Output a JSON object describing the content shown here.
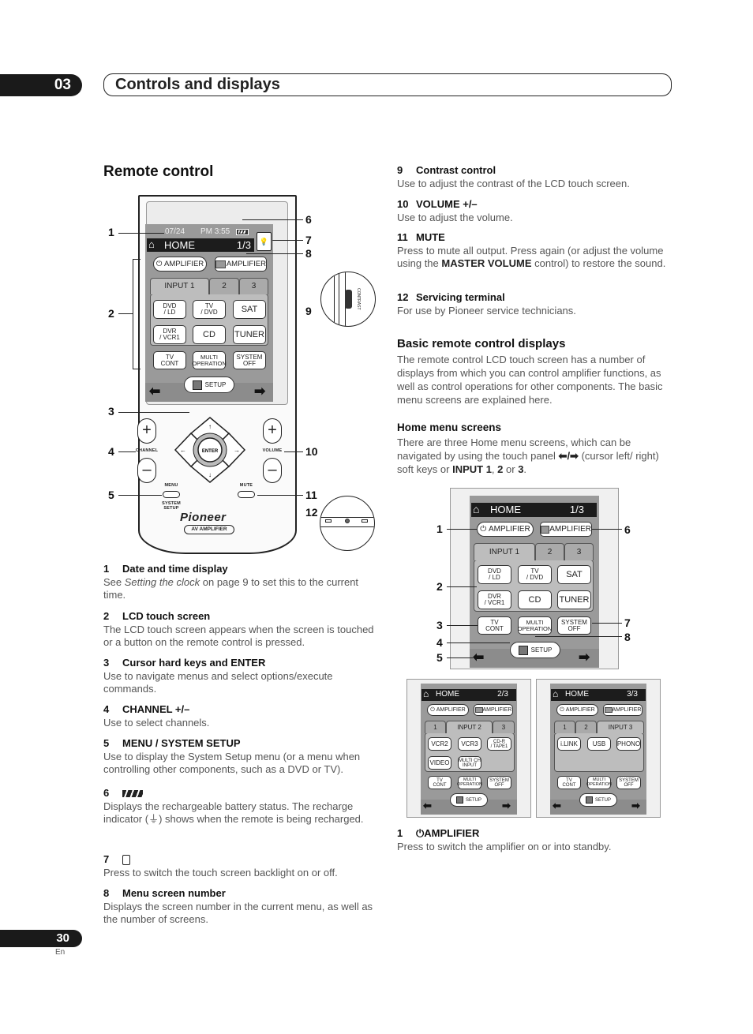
{
  "header": {
    "chapter_number": "03",
    "chapter_title": "Controls and displays"
  },
  "footer": {
    "page_number": "30",
    "language": "En"
  },
  "left": {
    "section_title": "Remote control",
    "remote": {
      "date": "07/24",
      "time": "PM 3:55",
      "home_label": "HOME",
      "screen_number": "1/3",
      "power_amp_label": "AMPLIFIER",
      "amp_label": "AMPLIFIER",
      "tabs": [
        "INPUT 1",
        "2",
        "3"
      ],
      "input_buttons": [
        [
          "DVD",
          "/ LD"
        ],
        [
          "TV",
          "/ DVD"
        ],
        [
          "SAT"
        ],
        [
          "DVR",
          "/ VCR1"
        ],
        [
          "CD"
        ],
        [
          "TUNER"
        ]
      ],
      "bottom_buttons": [
        [
          "TV",
          "CONT"
        ],
        [
          "MULTI",
          "OPERATION"
        ],
        [
          "SYSTEM",
          "OFF"
        ]
      ],
      "setup_label": "SETUP",
      "channel_label": "CHANNEL",
      "volume_label": "VOLUME",
      "enter_label": "ENTER",
      "menu_label": "MENU",
      "system_setup_label": [
        "SYSTEM",
        "SETUP"
      ],
      "mute_label": "MUTE",
      "brand": "Pioneer",
      "model_label": "AV AMPLIFIER",
      "contrast_label": "CONTRAST",
      "callouts": [
        "1",
        "2",
        "3",
        "4",
        "5",
        "6",
        "7",
        "8",
        "9",
        "10",
        "11",
        "12"
      ]
    },
    "items": [
      {
        "num": "1",
        "title": "Date and time display",
        "body_pre": "See ",
        "body_italic": "Setting the clock",
        "body_post": " on page 9 to set this to the current time."
      },
      {
        "num": "2",
        "title": "LCD touch screen",
        "body": "The LCD touch screen appears when the screen is touched or a button on the remote control is pressed."
      },
      {
        "num": "3",
        "title": "Cursor hard keys and ENTER",
        "body": "Use to navigate menus and select options/execute commands."
      },
      {
        "num": "4",
        "title": "CHANNEL  +/–",
        "body": "Use to select channels."
      },
      {
        "num": "5",
        "title": "MENU / SYSTEM SETUP",
        "body": "Use to display the System Setup menu (or a menu when controlling other components, such as a DVD or TV)."
      },
      {
        "num": "6",
        "title_icon": "battery-icon",
        "body_pre": "Displays the rechargeable battery status. The recharge indicator (",
        "body_post": ") shows when the remote is being recharged."
      },
      {
        "num": "7",
        "title_icon": "backlight-icon",
        "body": "Press to switch the touch screen backlight on or off."
      },
      {
        "num": "8",
        "title": "Menu screen number",
        "body": "Displays the screen number in the current menu, as well as the number of screens."
      }
    ]
  },
  "right": {
    "items": [
      {
        "num": "9",
        "title": "Contrast control",
        "body": "Use to adjust the contrast of the LCD touch screen."
      },
      {
        "num": "10",
        "title": "VOLUME +/–",
        "body": "Use to adjust the volume."
      },
      {
        "num": "11",
        "title": "MUTE",
        "body_pre": "Press to mute all output. Press again (or adjust the volume using the ",
        "body_bold": "MASTER VOLUME",
        "body_post": " control) to restore the sound."
      },
      {
        "num": "12",
        "title": "Servicing terminal",
        "body": "For use by Pioneer service technicians."
      }
    ],
    "basic_title": "Basic remote control displays",
    "basic_body": "The remote control LCD touch screen has a number of displays from which you can control amplifier functions, as well as control operations for other components. The basic menu screens are explained here.",
    "home_title": "Home menu screens",
    "home_body_pre": "There are three Home menu screens, which can be navigated by using the touch panel ",
    "home_body_arrows": "⬅/➡",
    "home_body_mid": " (cursor left/ right) soft keys or ",
    "home_body_b1": "INPUT 1",
    "home_body_sep1": ", ",
    "home_body_b2": "2",
    "home_body_sep2": " or ",
    "home_body_b3": "3",
    "home_body_end": ".",
    "screens": [
      {
        "home_label": "HOME",
        "screen_number": "1/3",
        "power_amp_label": "AMPLIFIER",
        "amp_label": "AMPLIFIER",
        "tabs": [
          "INPUT 1",
          "2",
          "3"
        ],
        "buttons": [
          [
            "DVD",
            "/ LD"
          ],
          [
            "TV",
            "/ DVD"
          ],
          [
            "SAT"
          ],
          [
            "DVR",
            "/ VCR1"
          ],
          [
            "CD"
          ],
          [
            "TUNER"
          ]
        ],
        "bottom_buttons": [
          [
            "TV",
            "CONT"
          ],
          [
            "MULTI",
            "OPERATION"
          ],
          [
            "SYSTEM",
            "OFF"
          ]
        ],
        "setup_label": "SETUP",
        "callouts_left": [
          "1",
          "2",
          "3",
          "4",
          "5"
        ],
        "callouts_right": [
          "6",
          "7",
          "8"
        ]
      },
      {
        "home_label": "HOME",
        "screen_number": "2/3",
        "power_amp_label": "AMPLIFIER",
        "amp_label": "AMPLIFIER",
        "tabs": [
          "1",
          "INPUT 2",
          "3"
        ],
        "buttons": [
          [
            "VCR2"
          ],
          [
            "VCR3"
          ],
          [
            "CD-R",
            "/ TAPE1"
          ],
          [
            "VIDEO"
          ],
          [
            "MULTI CH",
            "INPUT"
          ]
        ],
        "bottom_buttons": [
          [
            "TV",
            "CONT"
          ],
          [
            "MULTI",
            "OPERATION"
          ],
          [
            "SYSTEM",
            "OFF"
          ]
        ],
        "setup_label": "SETUP"
      },
      {
        "home_label": "HOME",
        "screen_number": "3/3",
        "power_amp_label": "AMPLIFIER",
        "amp_label": "AMPLIFIER",
        "tabs": [
          "1",
          "2",
          "INPUT 3"
        ],
        "buttons": [
          [
            "i.LINK"
          ],
          [
            "USB"
          ],
          [
            "PHONO"
          ]
        ],
        "bottom_buttons": [
          [
            "TV",
            "CONT"
          ],
          [
            "MULTI",
            "OPERATION"
          ],
          [
            "SYSTEM",
            "OFF"
          ]
        ],
        "setup_label": "SETUP"
      }
    ],
    "amp_item": {
      "num": "1",
      "title": "AMPLIFIER",
      "body": "Press to switch the amplifier on or into standby."
    }
  }
}
